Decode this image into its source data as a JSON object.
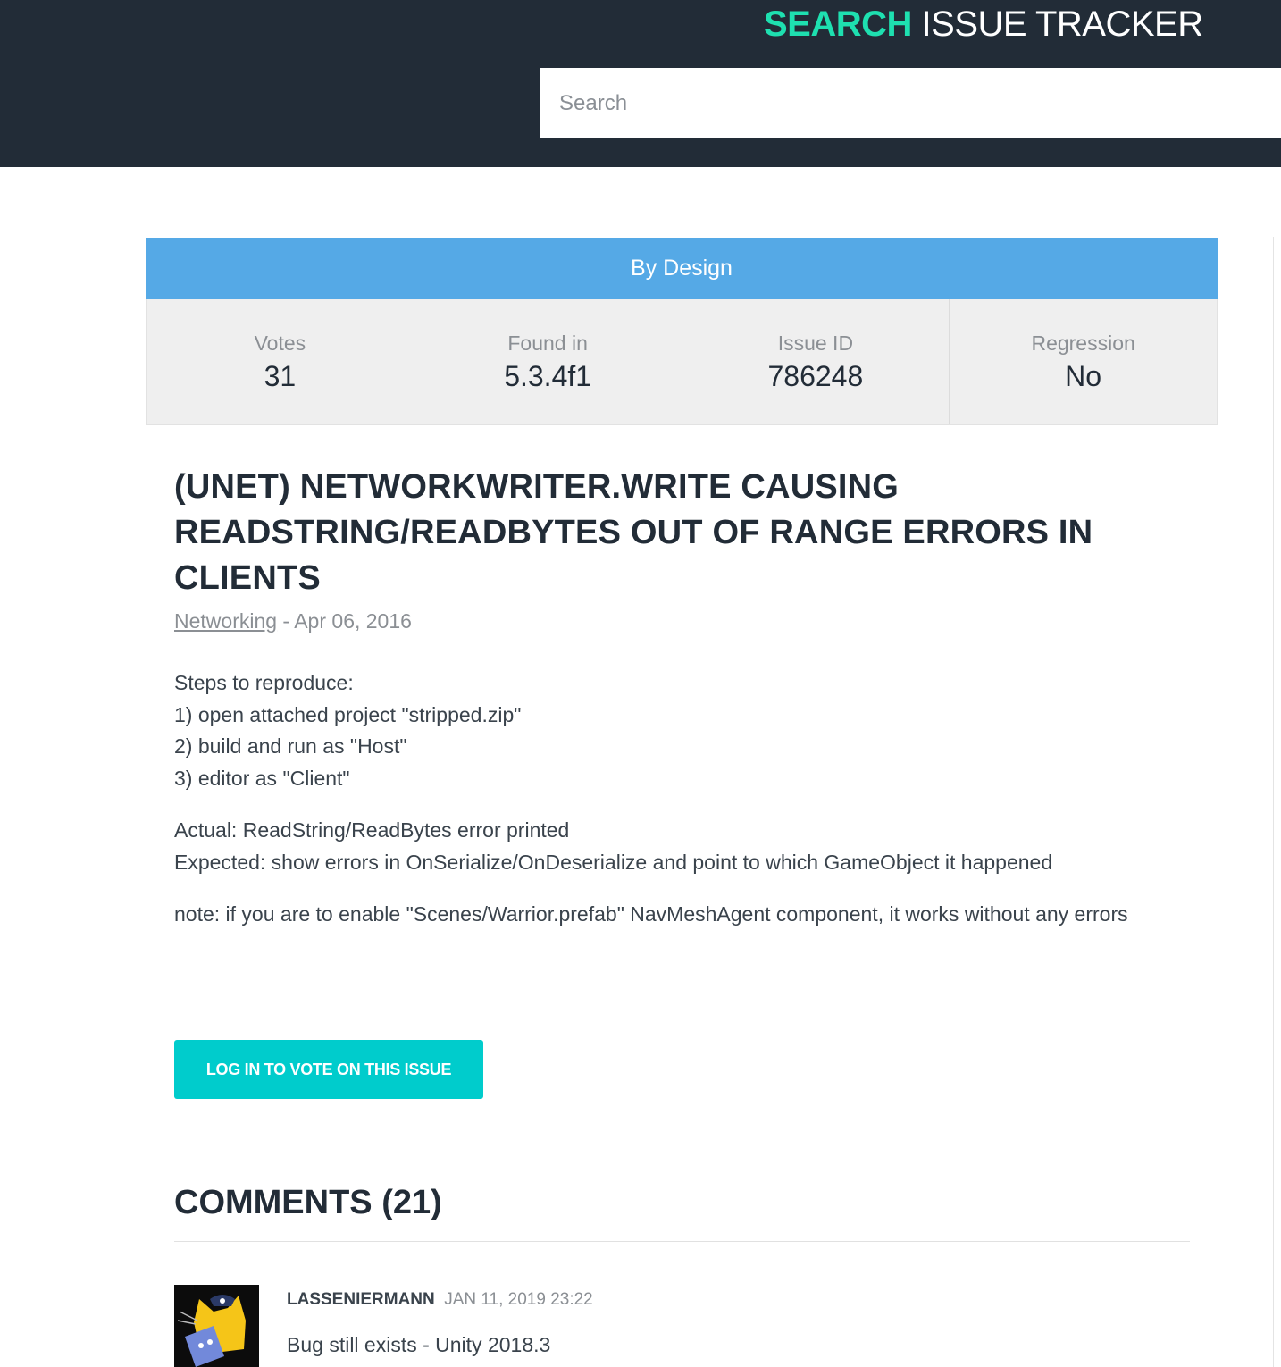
{
  "header": {
    "brand_highlight": "SEARCH",
    "brand_rest": "ISSUE TRACKER",
    "search_placeholder": "Search",
    "search_value": ""
  },
  "issue": {
    "status": "By Design",
    "stats": [
      {
        "label": "Votes",
        "value": "31"
      },
      {
        "label": "Found in",
        "value": "5.3.4f1"
      },
      {
        "label": "Issue ID",
        "value": "786248"
      },
      {
        "label": "Regression",
        "value": "No"
      }
    ],
    "title": "(UNET) NetworkWriter.Write causing ReadString/ReadBytes out of range errors in Clients",
    "category": "Networking",
    "date_separator": " - Apr 06, 2016",
    "description": [
      "Steps to reproduce:\n1) open attached project \"stripped.zip\"\n2) build and run as \"Host\"\n3) editor as \"Client\"",
      "Actual: ReadString/ReadBytes error printed\nExpected: show errors in OnSerialize/OnDeserialize and point to which GameObject it happened",
      "note: if you are to enable \"Scenes/Warrior.prefab\" NavMeshAgent component, it works without any errors"
    ],
    "vote_button_label": "Log in to vote on this issue"
  },
  "comments": {
    "title": "COMMENTS (21)",
    "items": [
      {
        "user": "LasseNiermann",
        "date": "JAN 11, 2019 23:22",
        "body": "Bug still exists - Unity 2018.3"
      }
    ]
  },
  "colors": {
    "header_bg": "#222c37",
    "brand_accent": "#1ee0b0",
    "status_bar": "#55a9e6",
    "vote_button": "#00cccc"
  }
}
